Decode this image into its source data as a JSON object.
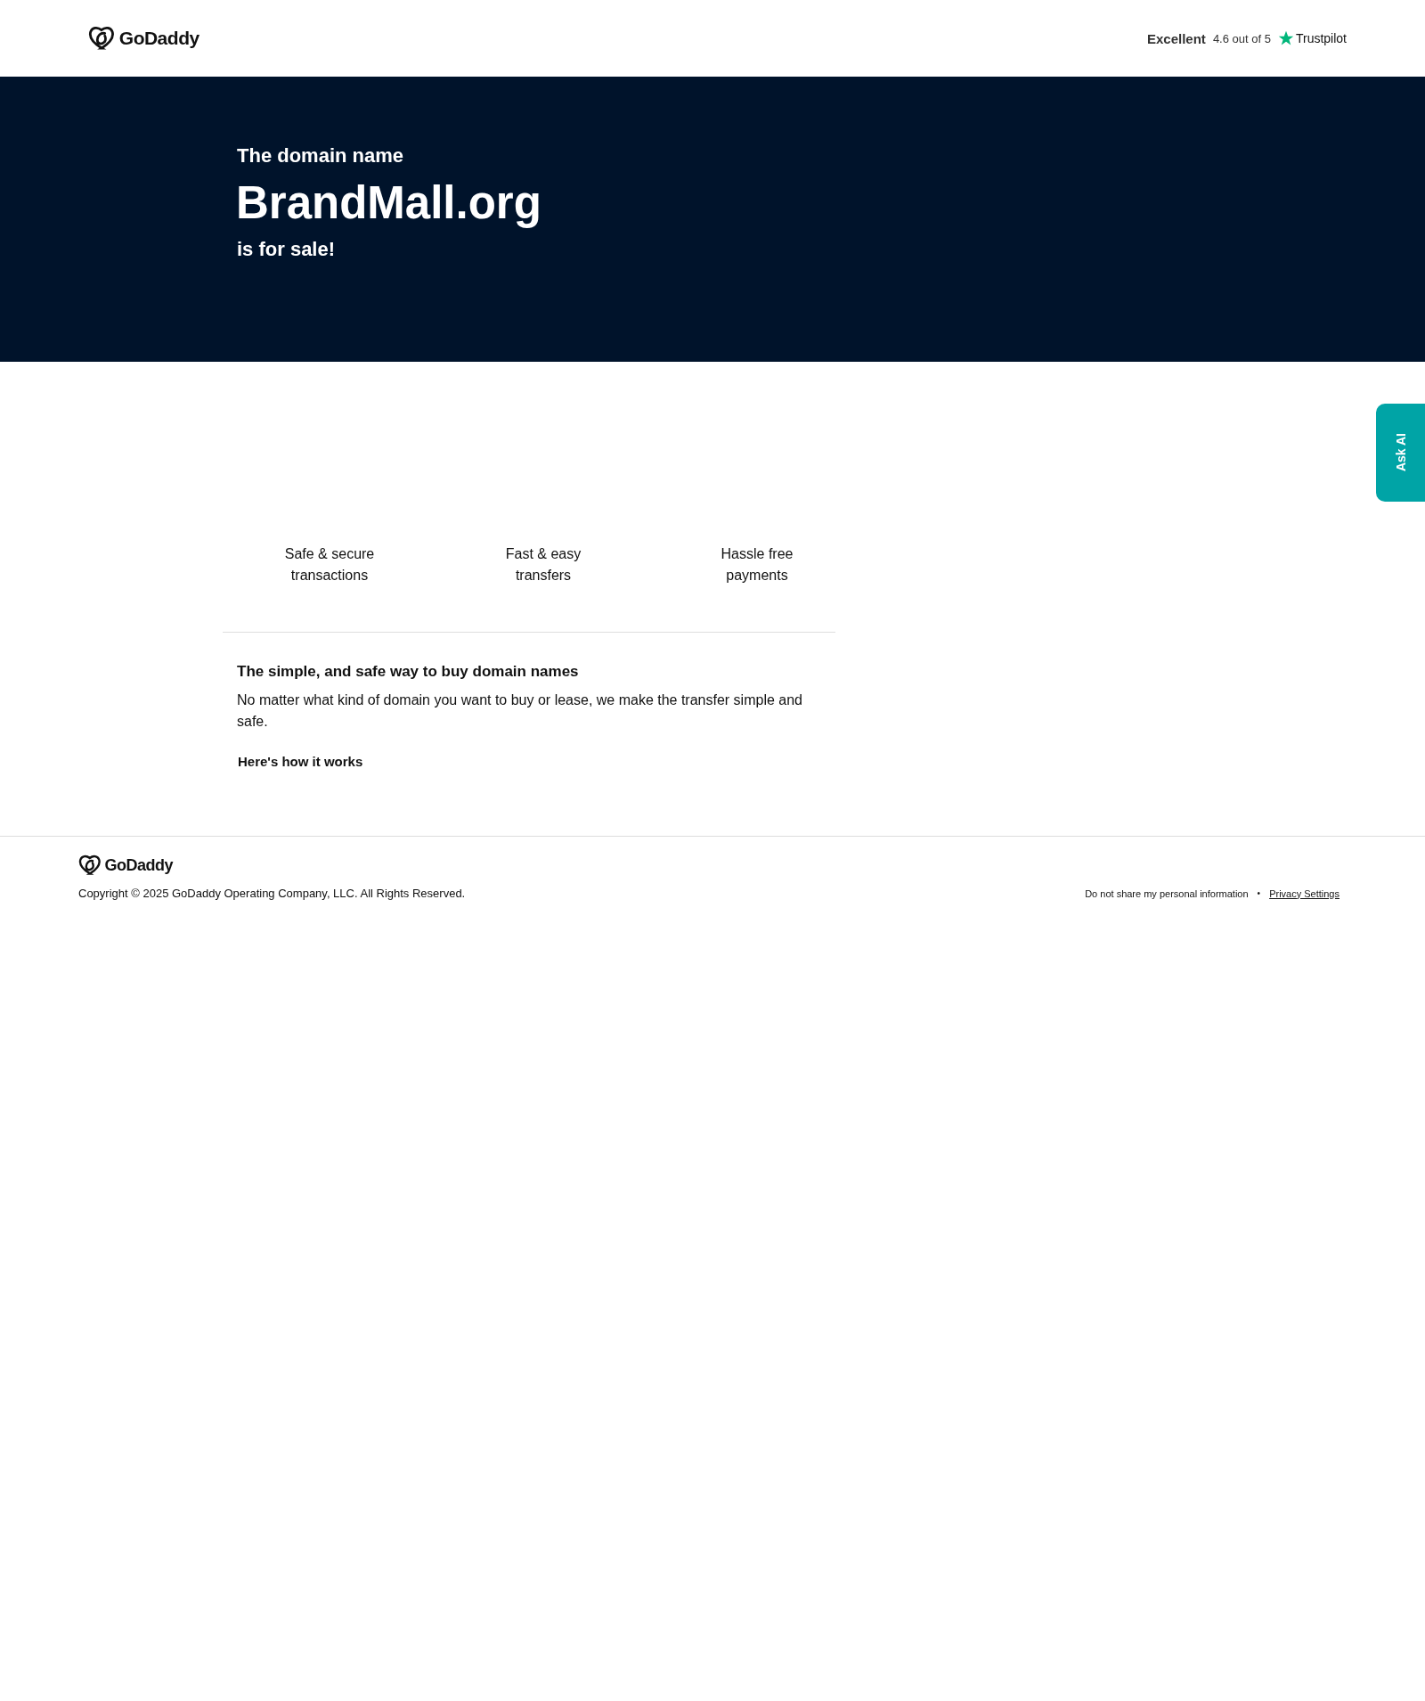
{
  "header": {
    "logo": "GoDaddy",
    "rating": {
      "label": "Excellent",
      "score": "4.6 out of 5",
      "brand": "Trustpilot"
    }
  },
  "hero": {
    "intro": "The domain name",
    "domain": "BrandMall.org",
    "outro": "is for sale!"
  },
  "features": [
    "Safe & secure transactions",
    "Fast & easy transfers",
    "Hassle free payments"
  ],
  "info": {
    "heading": "The simple, and safe way to buy domain names",
    "body": "No matter what kind of domain you want to buy or lease, we make the transfer simple and safe.",
    "link": "Here's how it works"
  },
  "ask_ai": "Ask AI",
  "footer": {
    "logo": "GoDaddy",
    "copyright": "Copyright © 2025 GoDaddy Operating Company, LLC. All Rights Reserved.",
    "links": [
      "Do not share my personal information",
      "Privacy Settings"
    ],
    "separator": "•"
  }
}
